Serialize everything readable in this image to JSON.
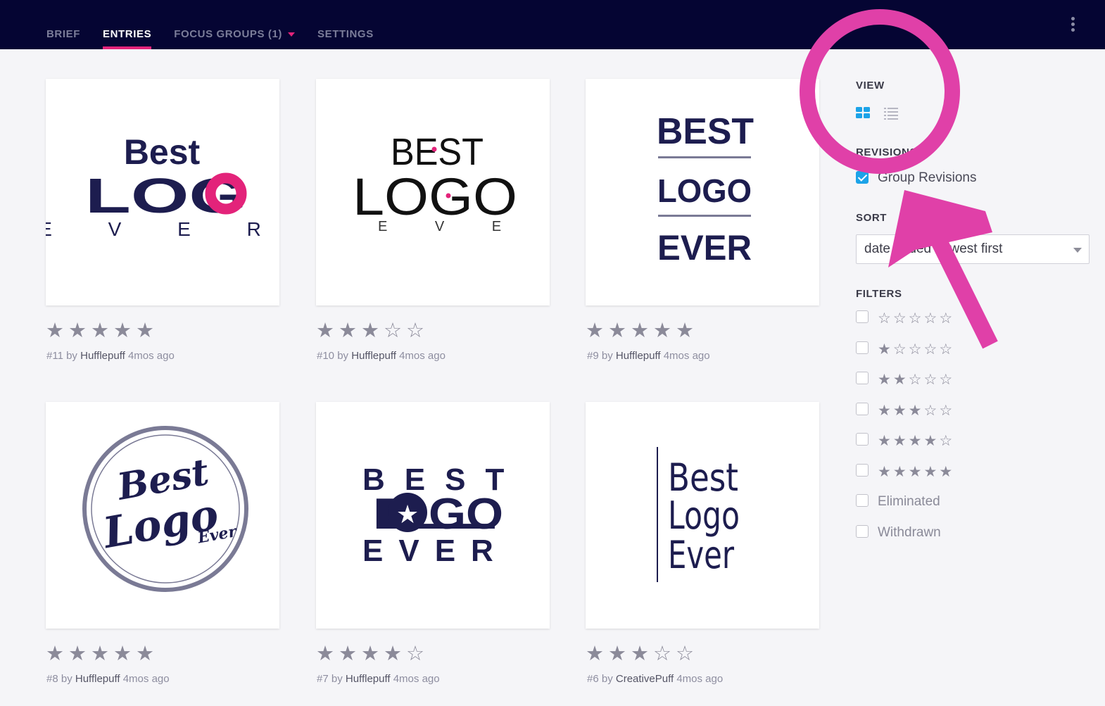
{
  "nav": {
    "tabs": [
      {
        "label": "BRIEF"
      },
      {
        "label": "ENTRIES"
      },
      {
        "label": "FOCUS GROUPS (1)"
      },
      {
        "label": "SETTINGS"
      }
    ],
    "active_tab": "ENTRIES"
  },
  "entries": [
    {
      "number": "#11",
      "by": "by",
      "author": "Hufflepuff",
      "age": "4mos ago",
      "rating": 5,
      "logo_lines": [
        "Best",
        "LOGO",
        "E V E R"
      ]
    },
    {
      "number": "#10",
      "by": "by",
      "author": "Hufflepuff",
      "age": "4mos ago",
      "rating": 3,
      "logo_lines": [
        "BEST",
        "LOGO",
        "E V E R"
      ]
    },
    {
      "number": "#9",
      "by": "by",
      "author": "Hufflepuff",
      "age": "4mos ago",
      "rating": 5,
      "logo_lines": [
        "BEST",
        "LOGO",
        "EVER"
      ]
    },
    {
      "number": "#8",
      "by": "by",
      "author": "Hufflepuff",
      "age": "4mos ago",
      "rating": 5,
      "logo_lines": [
        "Best",
        "Logo",
        "Ever"
      ]
    },
    {
      "number": "#7",
      "by": "by",
      "author": "Hufflepuff",
      "age": "4mos ago",
      "rating": 4,
      "logo_lines": [
        "BEST",
        "LOGO",
        "EVER"
      ]
    },
    {
      "number": "#6",
      "by": "by",
      "author": "CreativePuff",
      "age": "4mos ago",
      "rating": 3,
      "logo_lines": [
        "Best",
        "Logo",
        "Ever"
      ]
    }
  ],
  "sidebar": {
    "view_label": "VIEW",
    "view_modes": [
      {
        "icon": "grid-icon",
        "selected": true
      },
      {
        "icon": "list-icon",
        "selected": false
      }
    ],
    "revisions_label": "REVISIONS",
    "group_revisions": {
      "label": "Group Revisions",
      "checked": true
    },
    "sort_label": "SORT",
    "sort_value": "date added newest first",
    "filters_label": "FILTERS",
    "star_filters": [
      {
        "stars": 0,
        "checked": false
      },
      {
        "stars": 1,
        "checked": false
      },
      {
        "stars": 2,
        "checked": false
      },
      {
        "stars": 3,
        "checked": false
      },
      {
        "stars": 4,
        "checked": false
      },
      {
        "stars": 5,
        "checked": false
      }
    ],
    "status_filters": [
      {
        "label": "Eliminated",
        "checked": false
      },
      {
        "label": "Withdrawn",
        "checked": false
      }
    ]
  },
  "colors": {
    "nav_bg": "#050533",
    "accent": "#e3237a",
    "logo_navy": "#1d1d4f",
    "checkbox_blue": "#1ca3e8",
    "annotation_magenta": "#e040a8",
    "star_gray": "#8b8a99"
  },
  "annotation": {
    "shape": "circle-and-arrow",
    "target": "view-toggle"
  }
}
